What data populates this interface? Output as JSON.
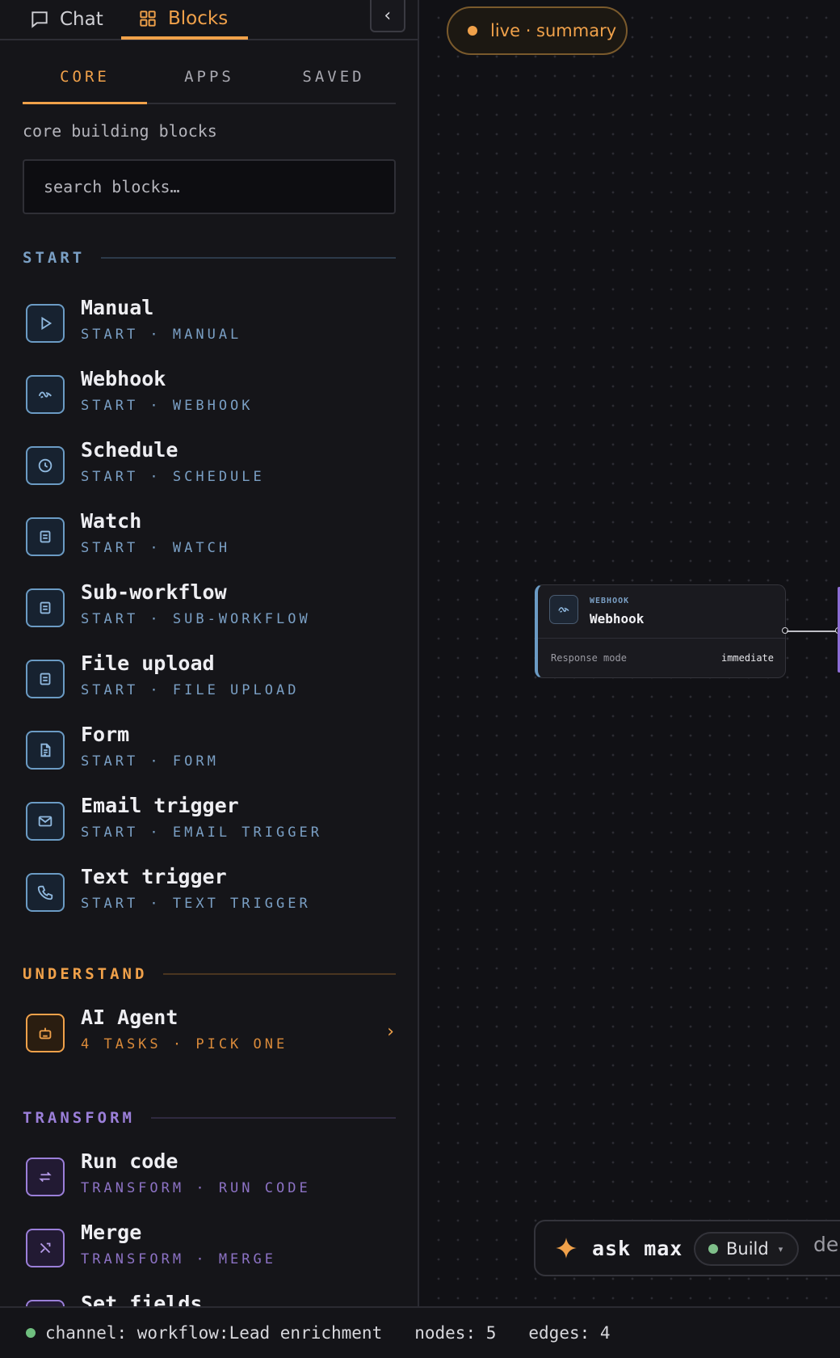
{
  "top_tabs": {
    "chat": "Chat",
    "blocks": "Blocks"
  },
  "sub_tabs": [
    "CORE",
    "APPS",
    "SAVED"
  ],
  "section_desc": "core building blocks",
  "search": {
    "placeholder": "search blocks…"
  },
  "groups": {
    "start": {
      "label": "START",
      "color": "#7a9fc4",
      "items": [
        {
          "title": "Manual",
          "sub": "START · MANUAL",
          "icon": "play-icon"
        },
        {
          "title": "Webhook",
          "sub": "START · WEBHOOK",
          "icon": "webhook-icon"
        },
        {
          "title": "Schedule",
          "sub": "START · SCHEDULE",
          "icon": "clock-icon"
        },
        {
          "title": "Watch",
          "sub": "START · WATCH",
          "icon": "list-icon"
        },
        {
          "title": "Sub-workflow",
          "sub": "START · SUB-WORKFLOW",
          "icon": "list-icon"
        },
        {
          "title": "File upload",
          "sub": "START · FILE UPLOAD",
          "icon": "list-icon"
        },
        {
          "title": "Form",
          "sub": "START · FORM",
          "icon": "document-icon"
        },
        {
          "title": "Email trigger",
          "sub": "START · EMAIL TRIGGER",
          "icon": "mail-icon"
        },
        {
          "title": "Text trigger",
          "sub": "START · TEXT TRIGGER",
          "icon": "phone-icon"
        }
      ]
    },
    "understand": {
      "label": "UNDERSTAND",
      "color": "#f0a14a",
      "items": [
        {
          "title": "AI Agent",
          "sub": "4 TASKS · PICK ONE",
          "icon": "robot-icon"
        }
      ]
    },
    "transform": {
      "label": "TRANSFORM",
      "color": "#9b7fd9",
      "items": [
        {
          "title": "Run code",
          "sub": "TRANSFORM · RUN CODE",
          "icon": "swap-icon"
        },
        {
          "title": "Merge",
          "sub": "TRANSFORM · MERGE",
          "icon": "merge-icon"
        },
        {
          "title": "Set fields",
          "sub": "",
          "icon": "list-icon"
        }
      ]
    }
  },
  "canvas": {
    "live_pill": "live · summary",
    "node": {
      "kind": "WEBHOOK",
      "name": "Webhook",
      "field_key": "Response mode",
      "field_value": "immediate"
    },
    "ask_bar": {
      "label": "ask max",
      "mode": "Build",
      "trailing": "de"
    }
  },
  "status_bar": {
    "channel": "channel: workflow:Lead enrichment",
    "nodes": "nodes: 5",
    "edges": "edges: 4"
  },
  "colors": {
    "accent": "#f0a14a",
    "start": "#7a9fc4",
    "transform": "#9b7fd9",
    "ok": "#6fbf7f"
  }
}
